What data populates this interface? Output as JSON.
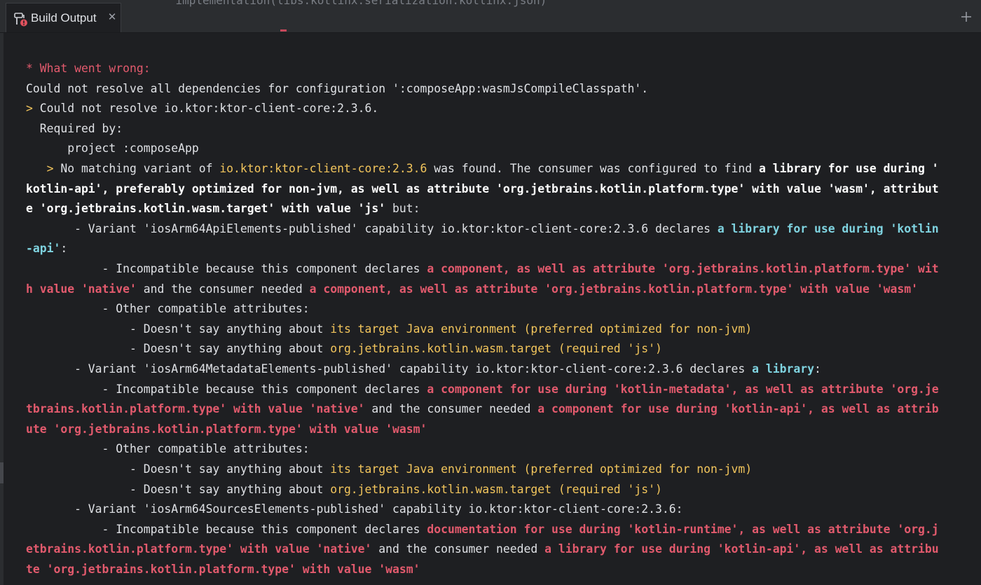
{
  "tab": {
    "label": "Build Output",
    "behind_text": "implementation(libs.kotlinx.serialization.kotlinx.json)"
  },
  "colors": {
    "background": "#1e1f22",
    "tabbar": "#2b2d30",
    "text": "#dfe1e5",
    "error_red": "#e25a6d",
    "highlight_yellow": "#f2c55c",
    "highlight_cyan": "#7fd3e0"
  },
  "icons": {
    "tab": "build-error-icon",
    "close": "close-icon",
    "add": "add-tab-icon"
  },
  "console": {
    "lines": [
      [
        {
          "t": "* What went wrong:",
          "s": "r"
        }
      ],
      [
        {
          "t": "Could not resolve all dependencies for configuration ':composeApp:wasmJsCompileClasspath'.",
          "s": "w"
        }
      ],
      [
        {
          "t": "> ",
          "s": "y"
        },
        {
          "t": "Could not resolve io.ktor:ktor-client-core:2.3.6.",
          "s": "w"
        }
      ],
      [
        {
          "t": "  Required by:",
          "s": "w"
        }
      ],
      [
        {
          "t": "      project :composeApp",
          "s": "w"
        }
      ],
      [
        {
          "t": "   > ",
          "s": "y"
        },
        {
          "t": "No matching variant of ",
          "s": "w"
        },
        {
          "t": "io.ktor:ktor-client-core:2.3.6",
          "s": "y"
        },
        {
          "t": " was found. The consumer was configured to find ",
          "s": "w"
        },
        {
          "t": "a library for use during '",
          "s": "b"
        }
      ],
      [
        {
          "t": "kotlin-api', preferably optimized for non-jvm, as well as attribute 'org.jetbrains.kotlin.platform.type' with value 'wasm', attribut",
          "s": "b"
        }
      ],
      [
        {
          "t": "e 'org.jetbrains.kotlin.wasm.target' with value 'js'",
          "s": "b"
        },
        {
          "t": " but:",
          "s": "w"
        }
      ],
      [
        {
          "t": "       - Variant 'iosArm64ApiElements-published' capability io.ktor:ktor-client-core:2.3.6 declares ",
          "s": "w"
        },
        {
          "t": "a library for use during 'kotlin",
          "s": "c"
        }
      ],
      [
        {
          "t": "-api'",
          "s": "c"
        },
        {
          "t": ":",
          "s": "w"
        }
      ],
      [
        {
          "t": "           - Incompatible because this component declares ",
          "s": "w"
        },
        {
          "t": "a component, as well as attribute 'org.jetbrains.kotlin.platform.type' wit",
          "s": "rb"
        }
      ],
      [
        {
          "t": "h value 'native'",
          "s": "rb"
        },
        {
          "t": " and the consumer needed ",
          "s": "w"
        },
        {
          "t": "a component, as well as attribute 'org.jetbrains.kotlin.platform.type' with value 'wasm'",
          "s": "rb"
        }
      ],
      [
        {
          "t": "           - Other compatible attributes:",
          "s": "w"
        }
      ],
      [
        {
          "t": "               - Doesn't say anything about ",
          "s": "w"
        },
        {
          "t": "its target Java environment (preferred optimized for non-jvm)",
          "s": "y"
        }
      ],
      [
        {
          "t": "               - Doesn't say anything about ",
          "s": "w"
        },
        {
          "t": "org.jetbrains.kotlin.wasm.target (required 'js')",
          "s": "y"
        }
      ],
      [
        {
          "t": "       - Variant 'iosArm64MetadataElements-published' capability io.ktor:ktor-client-core:2.3.6 declares ",
          "s": "w"
        },
        {
          "t": "a library",
          "s": "c"
        },
        {
          "t": ":",
          "s": "w"
        }
      ],
      [
        {
          "t": "           - Incompatible because this component declares ",
          "s": "w"
        },
        {
          "t": "a component for use during 'kotlin-metadata', as well as attribute 'org.je",
          "s": "rb"
        }
      ],
      [
        {
          "t": "tbrains.kotlin.platform.type' with value 'native'",
          "s": "rb"
        },
        {
          "t": " and the consumer needed ",
          "s": "w"
        },
        {
          "t": "a component for use during 'kotlin-api', as well as attrib",
          "s": "rb"
        }
      ],
      [
        {
          "t": "ute 'org.jetbrains.kotlin.platform.type' with value 'wasm'",
          "s": "rb"
        }
      ],
      [
        {
          "t": "           - Other compatible attributes:",
          "s": "w"
        }
      ],
      [
        {
          "t": "               - Doesn't say anything about ",
          "s": "w"
        },
        {
          "t": "its target Java environment (preferred optimized for non-jvm)",
          "s": "y"
        }
      ],
      [
        {
          "t": "               - Doesn't say anything about ",
          "s": "w"
        },
        {
          "t": "org.jetbrains.kotlin.wasm.target (required 'js')",
          "s": "y"
        }
      ],
      [
        {
          "t": "       - Variant 'iosArm64SourcesElements-published' capability io.ktor:ktor-client-core:2.3.6:",
          "s": "w"
        }
      ],
      [
        {
          "t": "           - Incompatible because this component declares ",
          "s": "w"
        },
        {
          "t": "documentation for use during 'kotlin-runtime', as well as attribute 'org.j",
          "s": "rb"
        }
      ],
      [
        {
          "t": "etbrains.kotlin.platform.type' with value 'native'",
          "s": "rb"
        },
        {
          "t": " and the consumer needed ",
          "s": "w"
        },
        {
          "t": "a library for use during 'kotlin-api', as well as attribu",
          "s": "rb"
        }
      ],
      [
        {
          "t": "te 'org.jetbrains.kotlin.platform.type' with value 'wasm'",
          "s": "rb"
        }
      ]
    ]
  }
}
